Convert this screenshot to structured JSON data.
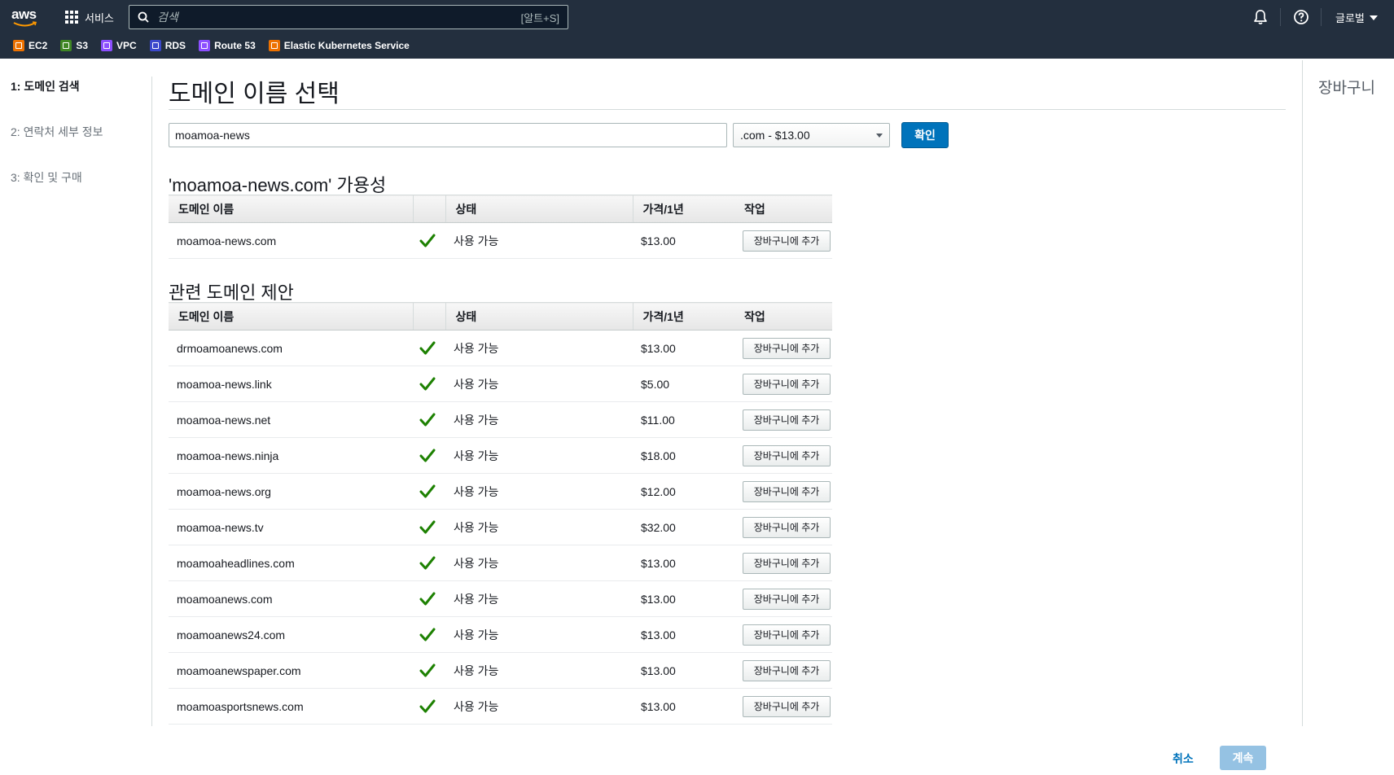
{
  "topnav": {
    "logo_text": "aws",
    "services_label": "서비스",
    "search_placeholder": "검색",
    "search_shortcut": "[알트+S]",
    "region_label": "글로벌",
    "favorites": [
      {
        "label": "EC2",
        "color": "#ed7100"
      },
      {
        "label": "S3",
        "color": "#3f8624"
      },
      {
        "label": "VPC",
        "color": "#8c4fff"
      },
      {
        "label": "RDS",
        "color": "#3b48cc"
      },
      {
        "label": "Route 53",
        "color": "#8c4fff"
      },
      {
        "label": "Elastic Kubernetes Service",
        "color": "#ed7100"
      }
    ]
  },
  "steps": [
    {
      "label": "1: 도메인 검색",
      "active": true
    },
    {
      "label": "2: 연락처 세부 정보",
      "active": false
    },
    {
      "label": "3: 확인 및 구매",
      "active": false
    }
  ],
  "main": {
    "title": "도메인 이름 선택",
    "domain_input_value": "moamoa-news",
    "tld_selected": ".com - $13.00",
    "confirm_label": "확인",
    "availability_title": "'moamoa-news.com' 가용성",
    "suggestions_title": "관련 도메인 제안",
    "columns": [
      "도메인 이름",
      "",
      "상태",
      "가격/1년",
      "작업"
    ],
    "primary_row": {
      "domain": "moamoa-news.com",
      "status": "사용 가능",
      "price": "$13.00",
      "action": "장바구니에 추가"
    },
    "suggestions": [
      {
        "domain": "drmoamoanews.com",
        "status": "사용 가능",
        "price": "$13.00",
        "action": "장바구니에 추가"
      },
      {
        "domain": "moamoa-news.link",
        "status": "사용 가능",
        "price": "$5.00",
        "action": "장바구니에 추가"
      },
      {
        "domain": "moamoa-news.net",
        "status": "사용 가능",
        "price": "$11.00",
        "action": "장바구니에 추가"
      },
      {
        "domain": "moamoa-news.ninja",
        "status": "사용 가능",
        "price": "$18.00",
        "action": "장바구니에 추가"
      },
      {
        "domain": "moamoa-news.org",
        "status": "사용 가능",
        "price": "$12.00",
        "action": "장바구니에 추가"
      },
      {
        "domain": "moamoa-news.tv",
        "status": "사용 가능",
        "price": "$32.00",
        "action": "장바구니에 추가"
      },
      {
        "domain": "moamoaheadlines.com",
        "status": "사용 가능",
        "price": "$13.00",
        "action": "장바구니에 추가"
      },
      {
        "domain": "moamoanews.com",
        "status": "사용 가능",
        "price": "$13.00",
        "action": "장바구니에 추가"
      },
      {
        "domain": "moamoanews24.com",
        "status": "사용 가능",
        "price": "$13.00",
        "action": "장바구니에 추가"
      },
      {
        "domain": "moamoanewspaper.com",
        "status": "사용 가능",
        "price": "$13.00",
        "action": "장바구니에 추가"
      },
      {
        "domain": "moamoasportsnews.com",
        "status": "사용 가능",
        "price": "$13.00",
        "action": "장바구니에 추가"
      }
    ]
  },
  "cart": {
    "title": "장바구니"
  },
  "footer": {
    "cancel_label": "취소",
    "continue_label": "계속"
  },
  "colors": {
    "nav_bg": "#232f3e",
    "primary_button": "#0073bb",
    "available_check": "#1d8102",
    "disabled_button": "#95c2e3"
  }
}
